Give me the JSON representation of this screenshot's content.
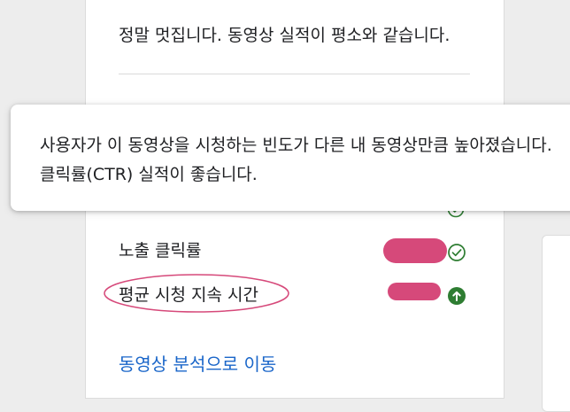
{
  "card": {
    "summary": "정말 멋집니다. 동영상 실적이 평소와 같습니다."
  },
  "metrics": [
    {
      "label": "노출 클릭률",
      "status": "normal",
      "status_icon": "check-circle-icon"
    },
    {
      "label": "평균 시청 지속 시간",
      "status": "above",
      "status_icon": "arrow-up-circle-icon"
    }
  ],
  "tooltip": {
    "text": "사용자가 이 동영상을 시청하는 빈도가 다른 내 동영상만큼 높아졌습니다. 클릭률(CTR) 실적이 좋습니다."
  },
  "link": {
    "label": "동영상 분석으로 이동"
  },
  "colors": {
    "status_ok_green": "#2e7d32",
    "link_blue": "#1a66c9",
    "redaction_pink": "#d6497a",
    "highlight_ellipse": "#d6497a"
  }
}
